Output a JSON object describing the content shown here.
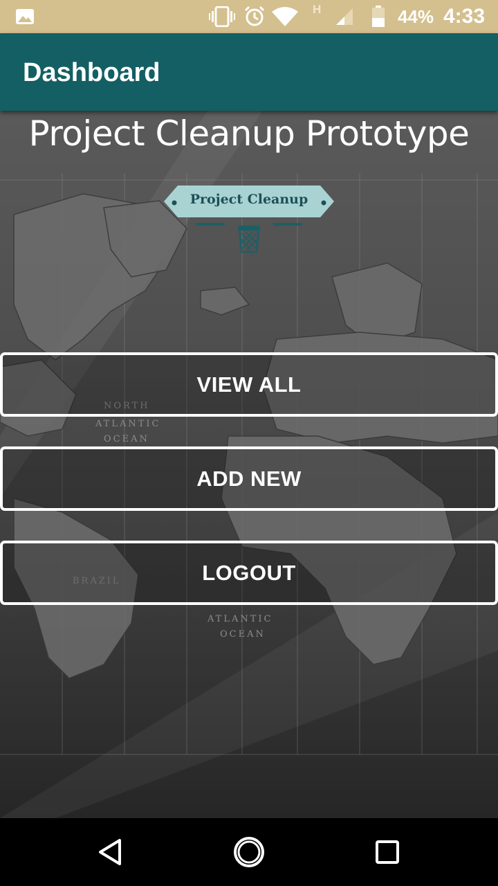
{
  "status_bar": {
    "battery_percent": "44%",
    "time": "4:33",
    "network_type": "H",
    "icons": [
      "gallery-icon",
      "vibrate-icon",
      "alarm-icon",
      "wifi-icon",
      "signal-icon",
      "battery-icon"
    ]
  },
  "app_bar": {
    "title": "Dashboard",
    "color": "#145f63"
  },
  "main": {
    "hero_title": "Project Cleanup Prototype",
    "logo": {
      "text": "Project Cleanup",
      "icon": "trash-bin-icon",
      "badge_color": "#a9d3d2",
      "accent_color": "#1d5f66"
    },
    "buttons": {
      "view_all": "VIEW ALL",
      "add_new": "ADD NEW",
      "logout": "LOGOUT"
    }
  },
  "nav_bar": {
    "icons": [
      "back-icon",
      "home-icon",
      "recents-icon"
    ]
  }
}
